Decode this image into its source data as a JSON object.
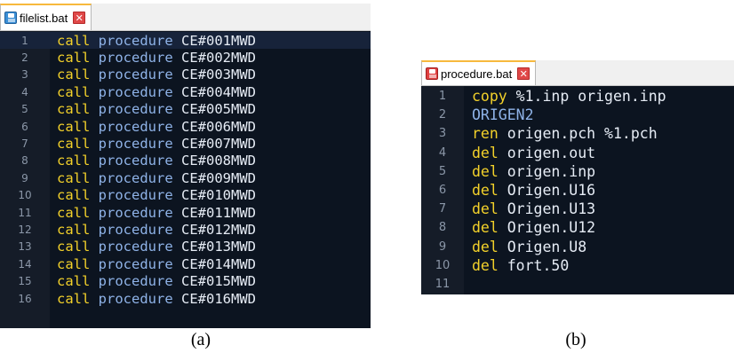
{
  "left_panel": {
    "tab_label": "filelist.bat",
    "lines": [
      {
        "num": "1",
        "kw": "call",
        "proc": "procedure",
        "arg": "CE#001MWD"
      },
      {
        "num": "2",
        "kw": "call",
        "proc": "procedure",
        "arg": "CE#002MWD"
      },
      {
        "num": "3",
        "kw": "call",
        "proc": "procedure",
        "arg": "CE#003MWD"
      },
      {
        "num": "4",
        "kw": "call",
        "proc": "procedure",
        "arg": "CE#004MWD"
      },
      {
        "num": "5",
        "kw": "call",
        "proc": "procedure",
        "arg": "CE#005MWD"
      },
      {
        "num": "6",
        "kw": "call",
        "proc": "procedure",
        "arg": "CE#006MWD"
      },
      {
        "num": "7",
        "kw": "call",
        "proc": "procedure",
        "arg": "CE#007MWD"
      },
      {
        "num": "8",
        "kw": "call",
        "proc": "procedure",
        "arg": "CE#008MWD"
      },
      {
        "num": "9",
        "kw": "call",
        "proc": "procedure",
        "arg": "CE#009MWD"
      },
      {
        "num": "10",
        "kw": "call",
        "proc": "procedure",
        "arg": "CE#010MWD"
      },
      {
        "num": "11",
        "kw": "call",
        "proc": "procedure",
        "arg": "CE#011MWD"
      },
      {
        "num": "12",
        "kw": "call",
        "proc": "procedure",
        "arg": "CE#012MWD"
      },
      {
        "num": "13",
        "kw": "call",
        "proc": "procedure",
        "arg": "CE#013MWD"
      },
      {
        "num": "14",
        "kw": "call",
        "proc": "procedure",
        "arg": "CE#014MWD"
      },
      {
        "num": "15",
        "kw": "call",
        "proc": "procedure",
        "arg": "CE#015MWD"
      },
      {
        "num": "16",
        "kw": "call",
        "proc": "procedure",
        "arg": "CE#016MWD"
      }
    ]
  },
  "right_panel": {
    "tab_label": "procedure.bat",
    "lines": [
      {
        "num": "1",
        "kw": "copy",
        "rest": " %1.inp origen.inp"
      },
      {
        "num": "2",
        "var": "ORIGEN2",
        "rest": ""
      },
      {
        "num": "3",
        "kw": "ren",
        "rest": " origen.pch %1.pch"
      },
      {
        "num": "4",
        "kw": "del",
        "rest": " origen.out"
      },
      {
        "num": "5",
        "kw": "del",
        "rest": " origen.inp"
      },
      {
        "num": "6",
        "kw": "del",
        "rest": " Origen.U16"
      },
      {
        "num": "7",
        "kw": "del",
        "rest": " Origen.U13"
      },
      {
        "num": "8",
        "kw": "del",
        "rest": " Origen.U12"
      },
      {
        "num": "9",
        "kw": "del",
        "rest": " Origen.U8"
      },
      {
        "num": "10",
        "kw": "del",
        "rest": " fort.50"
      },
      {
        "num": "11",
        "rest": ""
      }
    ]
  },
  "captions": {
    "a": "(a)",
    "b": "(b)"
  },
  "colors": {
    "editor_bg": "#0c1420",
    "keyword": "#f3d12a",
    "procedure": "#8fb3e8",
    "argument": "#e6ecf5",
    "tab_accent": "#f7b93d"
  }
}
